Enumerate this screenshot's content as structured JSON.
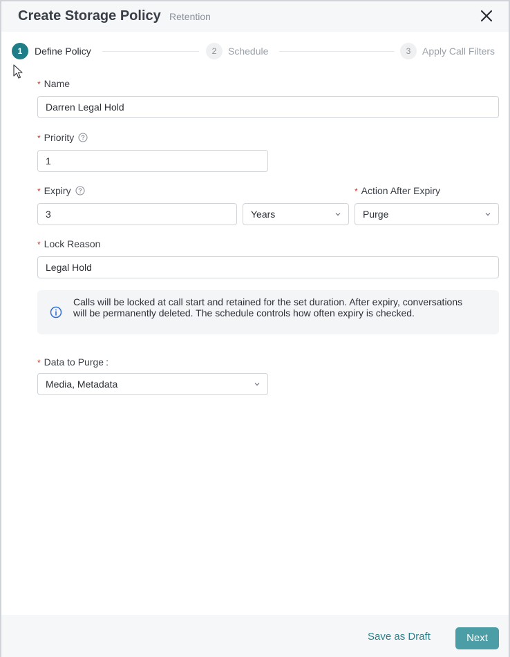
{
  "header": {
    "title": "Create Storage Policy",
    "subtitle": "Retention"
  },
  "steps": [
    {
      "number": "1",
      "label": "Define Policy",
      "state": "active"
    },
    {
      "number": "2",
      "label": "Schedule",
      "state": "idle"
    },
    {
      "number": "3",
      "label": "Apply Call Filters",
      "state": "idle"
    }
  ],
  "form": {
    "required_mark": "*",
    "name": {
      "label": "Name",
      "value": "Darren Legal Hold"
    },
    "priority": {
      "label": "Priority",
      "value": "1"
    },
    "expiry": {
      "label": "Expiry",
      "value": "3",
      "unit": "Years"
    },
    "action_after_expiry": {
      "label": "Action After Expiry",
      "value": "Purge"
    },
    "lock_reason": {
      "label": "Lock Reason",
      "value": "Legal Hold"
    },
    "info": "Calls will be locked at call start and retained for the set duration. After expiry, conversations will be permanently deleted. The schedule controls how often expiry is checked.",
    "data_to_purge": {
      "label": "Data to Purge",
      "colon": ":",
      "value": "Media, Metadata"
    }
  },
  "footer": {
    "save_draft": "Save as Draft",
    "next": "Next"
  },
  "icons": {
    "close": "close-icon",
    "help": "question-circle-icon",
    "info": "info-circle-icon",
    "chevron": "chevron-down-icon",
    "cursor": "mouse-pointer-icon"
  },
  "colors": {
    "accent": "#1e7d87",
    "primary_button": "#4b9ea6",
    "required": "#c0392b",
    "info_icon": "#2f6fd6"
  }
}
